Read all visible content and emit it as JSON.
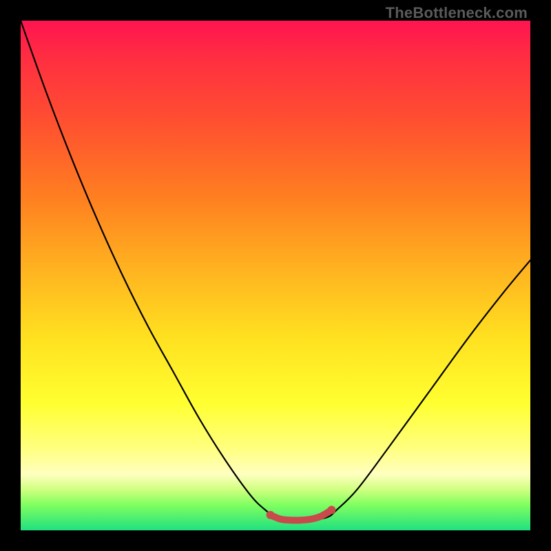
{
  "watermark": "TheBottleneck.com",
  "chart_data": {
    "type": "line",
    "title": "",
    "xlabel": "",
    "ylabel": "",
    "ylim": [
      0,
      1
    ],
    "xlim": [
      0,
      1
    ],
    "series": [
      {
        "name": "curve",
        "x": [
          0.0,
          0.05,
          0.1,
          0.15,
          0.2,
          0.25,
          0.3,
          0.35,
          0.4,
          0.45,
          0.48,
          0.51,
          0.56,
          0.6,
          0.62,
          0.66,
          0.72,
          0.8,
          0.88,
          0.95,
          1.0
        ],
        "y": [
          1.0,
          0.86,
          0.73,
          0.61,
          0.5,
          0.4,
          0.31,
          0.22,
          0.14,
          0.07,
          0.04,
          0.02,
          0.02,
          0.025,
          0.04,
          0.08,
          0.16,
          0.27,
          0.38,
          0.47,
          0.53
        ]
      },
      {
        "name": "marker-band",
        "x": [
          0.49,
          0.51,
          0.53,
          0.55,
          0.57,
          0.59,
          0.61
        ],
        "y": [
          0.03,
          0.022,
          0.02,
          0.02,
          0.022,
          0.028,
          0.04
        ]
      }
    ],
    "colors": {
      "curve": "#000000",
      "marker": "#c94a4a",
      "gradient_top": "#ff1450",
      "gradient_bottom": "#20e080"
    }
  }
}
